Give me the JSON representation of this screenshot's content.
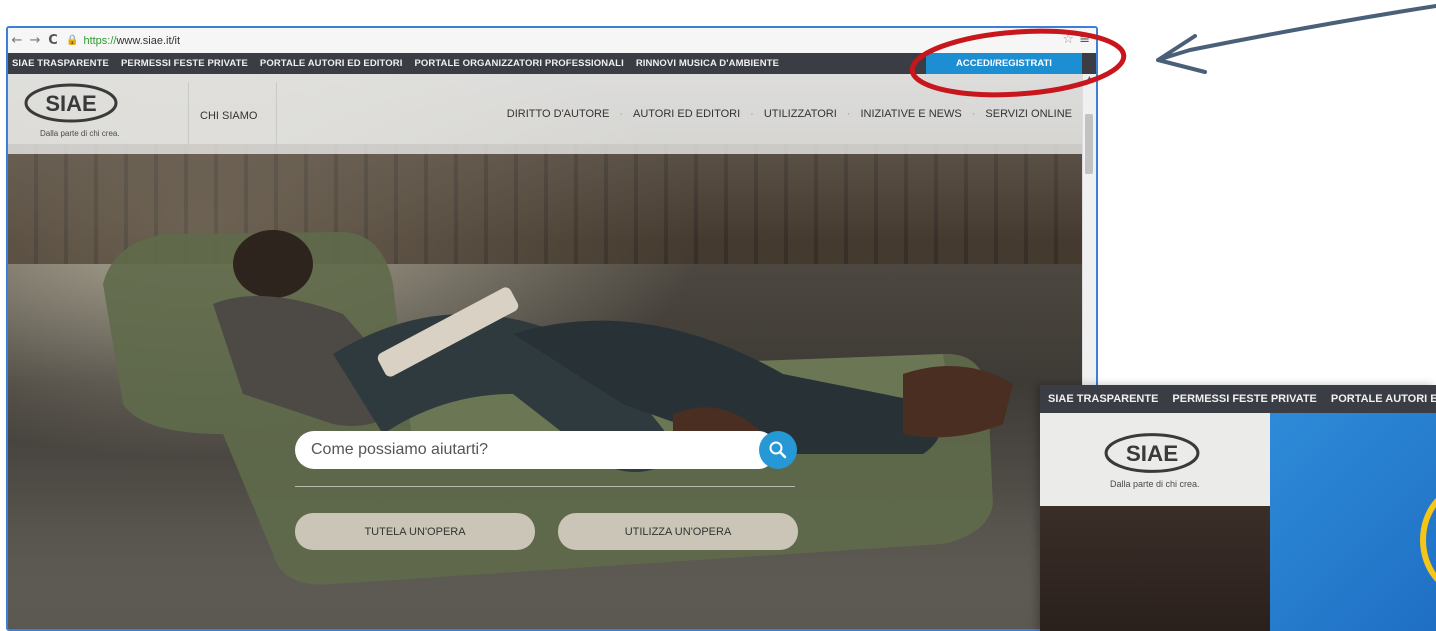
{
  "browser": {
    "url_scheme": "https://",
    "url_rest": "www.siae.it/it"
  },
  "topbar": {
    "items": [
      "SIAE TRASPARENTE",
      "PERMESSI FESTE PRIVATE",
      "PORTALE AUTORI ED EDITORI",
      "PORTALE ORGANIZZATORI PROFESSIONALI",
      "RINNOVI MUSICA D'AMBIENTE"
    ],
    "login": "ACCEDI/REGISTRATI"
  },
  "header": {
    "tagline": "Dalla parte di chi crea.",
    "chi_siamo": "CHI SIAMO",
    "nav": [
      "DIRITTO D'AUTORE",
      "AUTORI ED EDITORI",
      "UTILIZZATORI",
      "INIZIATIVE E NEWS",
      "SERVIZI ONLINE"
    ]
  },
  "search": {
    "placeholder": "Come possiamo aiutarti?"
  },
  "buttons": {
    "tutela": "TUTELA UN'OPERA",
    "utilizza": "UTILIZZA UN'OPERA"
  },
  "inset": {
    "topbar": [
      "SIAE TRASPARENTE",
      "PERMESSI FESTE PRIVATE",
      "PORTALE AUTORI ED"
    ],
    "tagline": "Dalla parte di chi crea."
  },
  "colors": {
    "topbar_bg": "#3a3d44",
    "login_bg": "#1c8ed2",
    "search_button": "#2798d6",
    "annotation": "#c8161d",
    "browser_border": "#3b7fd6"
  }
}
